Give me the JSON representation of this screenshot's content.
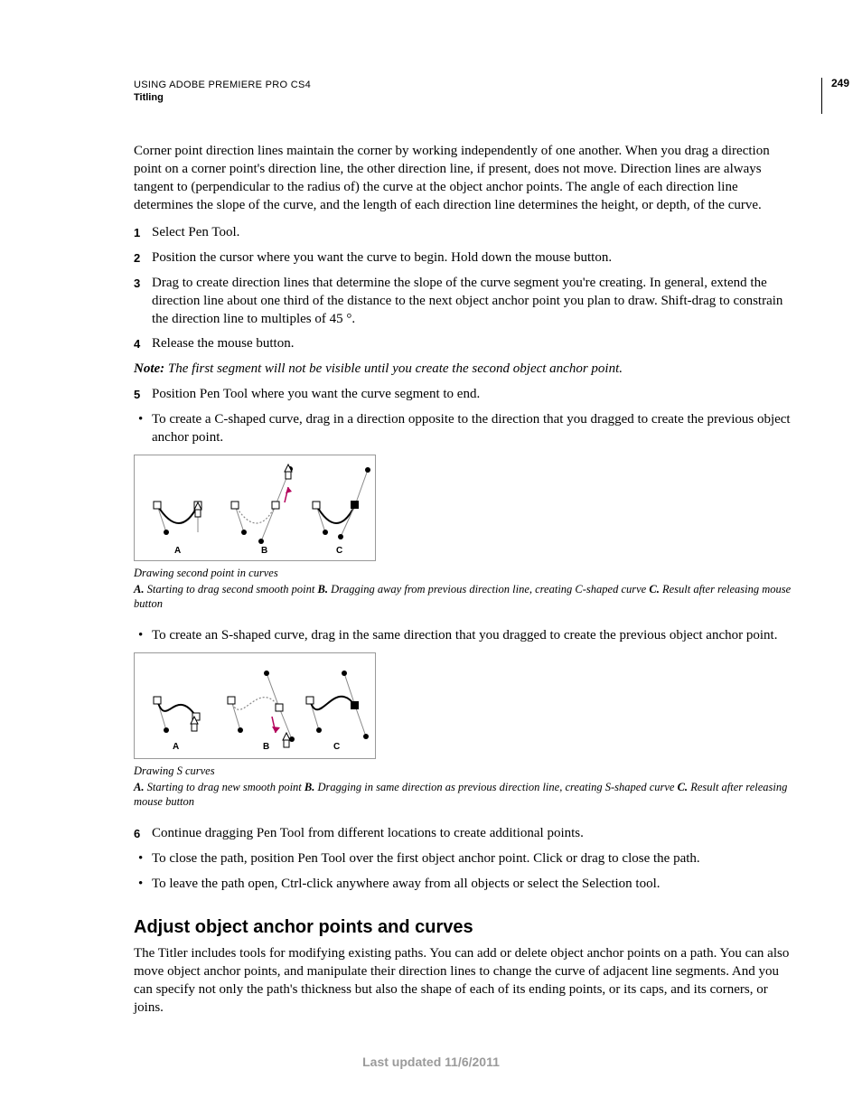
{
  "header": {
    "product": "USING ADOBE PREMIERE PRO CS4",
    "chapter": "Titling",
    "page_number": "249"
  },
  "para_corner": "Corner point direction lines maintain the corner by working independently of one another. When you drag a direction point on a corner point's direction line, the other direction line, if present, does not move. Direction lines are always tangent to (perpendicular to the radius of) the curve at the object anchor points. The angle of each direction line determines the slope of the curve, and the length of each direction line determines the height, or depth, of the curve.",
  "steps1": [
    "Select Pen Tool.",
    "Position the cursor where you want the curve to begin. Hold down the mouse button.",
    "Drag to create direction lines that determine the slope of the curve segment you're creating. In general, extend the direction line about one third of the distance to the next object anchor point you plan to draw. Shift-drag to constrain the direction line to multiples of 45 °.",
    "Release the mouse button."
  ],
  "note1": {
    "label": "Note:",
    "body": "The first segment will not be visible until you create the second object anchor point."
  },
  "step5": "Position Pen Tool where you want the curve segment to end.",
  "bullet_c": "To create a C-shaped curve, drag in a direction opposite to the direction that you dragged to create the previous object anchor point.",
  "fig1": {
    "title": "Drawing second point in curves",
    "A_prefix": "A.",
    "A_text": " Starting to drag second smooth point  ",
    "B_prefix": "B.",
    "B_text": " Dragging away from previous direction line, creating C-shaped curve  ",
    "C_prefix": "C.",
    "C_text": " Result after releasing mouse button",
    "labels": {
      "a": "A",
      "b": "B",
      "c": "C"
    }
  },
  "bullet_s": "To create an S-shaped curve, drag in the same direction that you dragged to create the previous object anchor point.",
  "fig2": {
    "title": "Drawing S curves",
    "A_prefix": "A.",
    "A_text": " Starting to drag new smooth point  ",
    "B_prefix": "B.",
    "B_text": " Dragging in same direction as previous direction line, creating S-shaped curve  ",
    "C_prefix": "C.",
    "C_text": " Result after releasing mouse button",
    "labels": {
      "a": "A",
      "b": "B",
      "c": "C"
    }
  },
  "step6": "Continue dragging Pen Tool from different locations to create additional points.",
  "bullets_end": [
    "To close the path, position Pen Tool over the first object anchor point. Click or drag to close the path.",
    "To leave the path open, Ctrl-click anywhere away from all objects or select the Selection tool."
  ],
  "section_heading": "Adjust object anchor points and curves",
  "para_adjust": "The Titler includes tools for modifying existing paths. You can add or delete object anchor points on a path. You can also move object anchor points, and manipulate their direction lines to change the curve of adjacent line segments. And you can specify not only the path's thickness but also the shape of each of its ending points, or its caps, and its corners, or joins.",
  "footer": "Last updated 11/6/2011"
}
